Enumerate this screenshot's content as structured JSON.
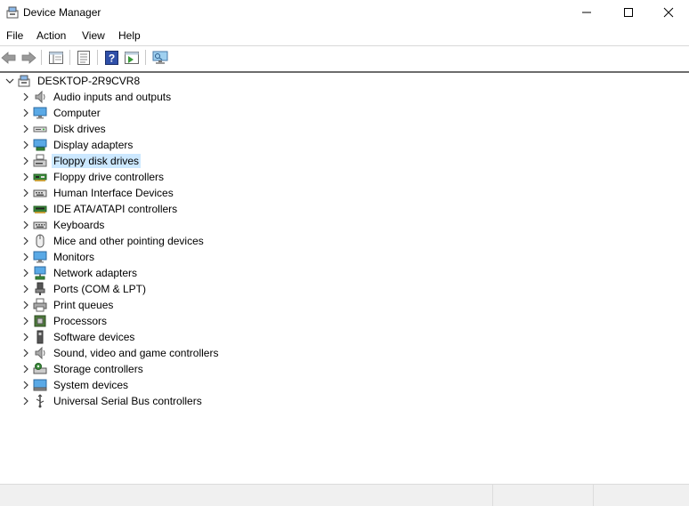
{
  "window": {
    "title": "Device Manager"
  },
  "menu": {
    "items": [
      "File",
      "Action",
      "View",
      "Help"
    ]
  },
  "toolbar": {
    "buttons": [
      "back-icon",
      "forward-icon",
      "show-hide-console-tree-icon",
      "properties-icon",
      "help-icon",
      "show-action-pane-icon",
      "scan-hardware-changes-icon"
    ]
  },
  "tree": {
    "root": "DESKTOP-2R9CVR8",
    "categories": [
      {
        "label": "Audio inputs and outputs",
        "icon": "speaker-icon"
      },
      {
        "label": "Computer",
        "icon": "computer-icon"
      },
      {
        "label": "Disk drives",
        "icon": "disk-drive-icon"
      },
      {
        "label": "Display adapters",
        "icon": "display-adapter-icon"
      },
      {
        "label": "Floppy disk drives",
        "icon": "floppy-drive-icon",
        "selected": true
      },
      {
        "label": "Floppy drive controllers",
        "icon": "floppy-controller-icon"
      },
      {
        "label": "Human Interface Devices",
        "icon": "hid-icon"
      },
      {
        "label": "IDE ATA/ATAPI controllers",
        "icon": "ide-controller-icon"
      },
      {
        "label": "Keyboards",
        "icon": "keyboard-icon"
      },
      {
        "label": "Mice and other pointing devices",
        "icon": "mouse-icon"
      },
      {
        "label": "Monitors",
        "icon": "monitor-icon"
      },
      {
        "label": "Network adapters",
        "icon": "network-adapter-icon"
      },
      {
        "label": "Ports (COM & LPT)",
        "icon": "port-icon"
      },
      {
        "label": "Print queues",
        "icon": "printer-icon"
      },
      {
        "label": "Processors",
        "icon": "processor-icon"
      },
      {
        "label": "Software devices",
        "icon": "software-device-icon"
      },
      {
        "label": "Sound, video and game controllers",
        "icon": "sound-controller-icon"
      },
      {
        "label": "Storage controllers",
        "icon": "storage-controller-icon"
      },
      {
        "label": "System devices",
        "icon": "system-device-icon"
      },
      {
        "label": "Universal Serial Bus controllers",
        "icon": "usb-icon"
      }
    ]
  },
  "colors": {
    "selection": "#cce8ff",
    "tree_border": "#6d6d6d",
    "statusbar": "#f0f0f0"
  }
}
